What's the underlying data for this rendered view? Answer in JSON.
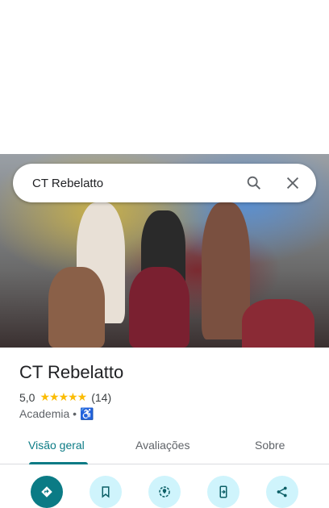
{
  "search": {
    "query": "CT Rebelatto",
    "search_icon": "search-icon",
    "close_icon": "close-icon"
  },
  "place": {
    "name": "CT Rebelatto",
    "rating": "5,0",
    "stars": "★★★★★",
    "rating_value": 5,
    "review_count": "(14)",
    "category": "Academia",
    "separator": "•",
    "accessibility_icon": "wheelchair-icon"
  },
  "tabs": [
    {
      "label": "Visão geral",
      "active": true
    },
    {
      "label": "Avaliações"
    },
    {
      "label": "Sobre"
    }
  ],
  "actions": [
    "directions-icon",
    "bookmark-icon",
    "nearby-icon",
    "send-to-phone-icon",
    "share-icon"
  ],
  "colors": {
    "accent": "#0b7b85",
    "star": "#fbbc04",
    "action_bg": "#cff4fc"
  }
}
